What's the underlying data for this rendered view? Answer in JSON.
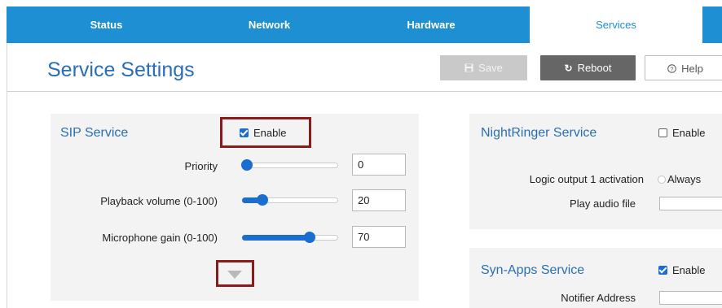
{
  "nav": {
    "tabs": [
      {
        "label": "Status"
      },
      {
        "label": "Network"
      },
      {
        "label": "Hardware"
      },
      {
        "label": "Services",
        "active": true
      }
    ]
  },
  "page": {
    "title": "Service Settings"
  },
  "toolbar": {
    "save_label": "Save",
    "reboot_label": "Reboot",
    "help_label": "Help"
  },
  "sip": {
    "title": "SIP Service",
    "enable_label": "Enable",
    "enabled": true,
    "rows": [
      {
        "label": "Priority",
        "value": "0",
        "level": 0
      },
      {
        "label": "Playback volume (0-100)",
        "value": "20",
        "level": 20
      },
      {
        "label": "Microphone gain (0-100)",
        "value": "70",
        "level": 70
      }
    ]
  },
  "nightringer": {
    "title": "NightRinger Service",
    "enable_label": "Enable",
    "enabled": false,
    "logic_label": "Logic output 1 activation",
    "logic_option": "Always",
    "audio_label": "Play audio file"
  },
  "synapps": {
    "title": "Syn-Apps Service",
    "enable_label": "Enable",
    "enabled": true,
    "notifier_label": "Notifier Address"
  },
  "colors": {
    "nav_bg": "#1f8fd4",
    "accent": "#1a6ecf",
    "title": "#2a6fb4",
    "highlight": "#8b1a1a"
  }
}
